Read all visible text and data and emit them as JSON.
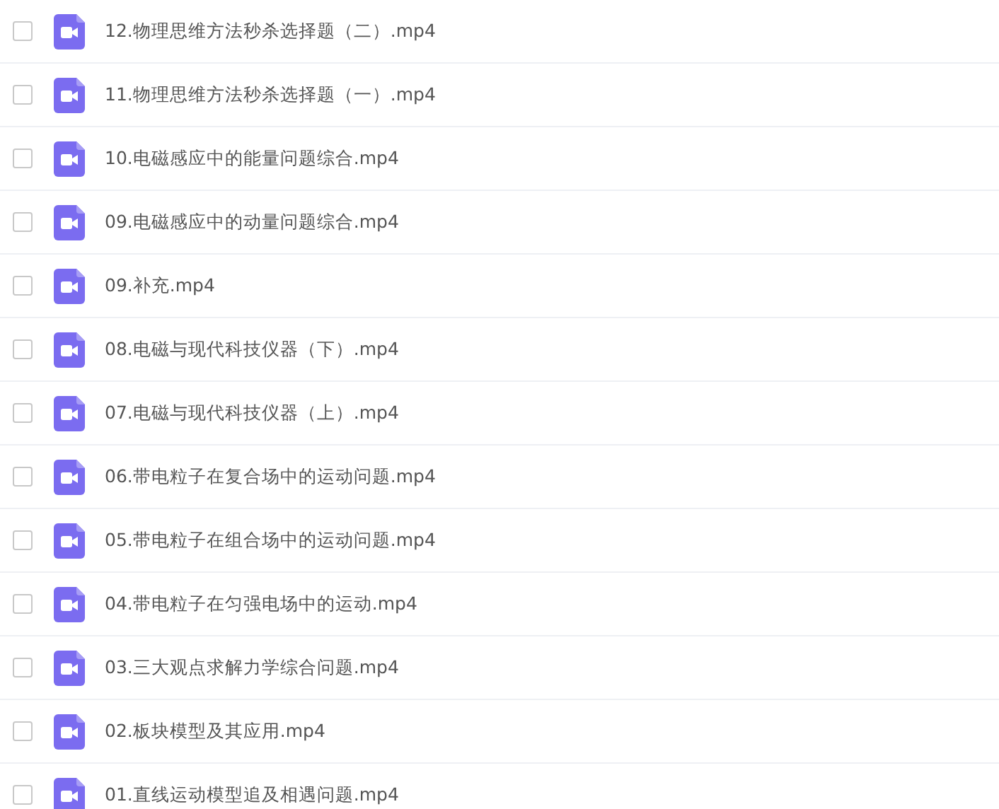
{
  "files": [
    {
      "name": "12.物理思维方法秒杀选择题（二）.mp4",
      "checked": false
    },
    {
      "name": "11.物理思维方法秒杀选择题（一）.mp4",
      "checked": false
    },
    {
      "name": "10.电磁感应中的能量问题综合.mp4",
      "checked": false
    },
    {
      "name": "09.电磁感应中的动量问题综合.mp4",
      "checked": false
    },
    {
      "name": "09.补充.mp4",
      "checked": false
    },
    {
      "name": "08.电磁与现代科技仪器（下）.mp4",
      "checked": false
    },
    {
      "name": "07.电磁与现代科技仪器（上）.mp4",
      "checked": false
    },
    {
      "name": "06.带电粒子在复合场中的运动问题.mp4",
      "checked": false
    },
    {
      "name": "05.带电粒子在组合场中的运动问题.mp4",
      "checked": false
    },
    {
      "name": "04.带电粒子在匀强电场中的运动.mp4",
      "checked": false
    },
    {
      "name": "03.三大观点求解力学综合问题.mp4",
      "checked": false
    },
    {
      "name": "02.板块模型及其应用.mp4",
      "checked": false
    },
    {
      "name": "01.直线运动模型追及相遇问题.mp4",
      "checked": false
    }
  ]
}
